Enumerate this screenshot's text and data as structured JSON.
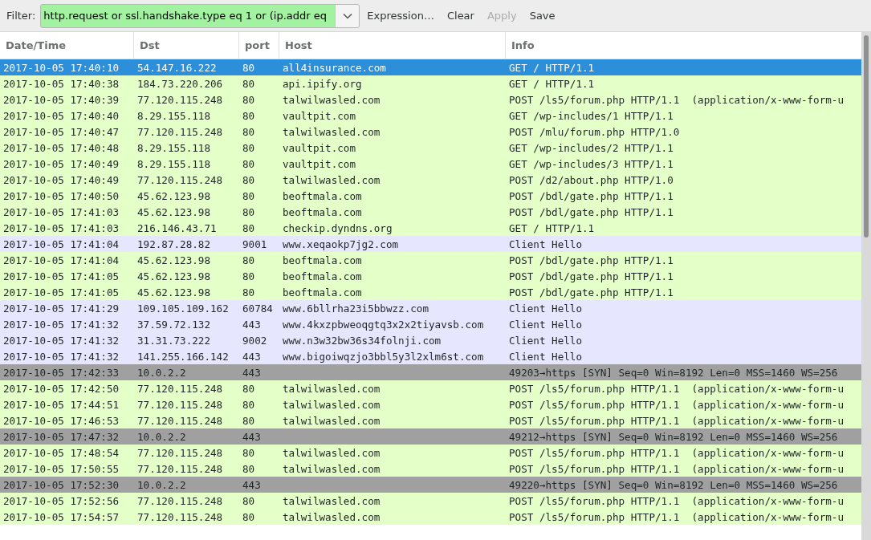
{
  "toolbar": {
    "filter_label": "Filter:",
    "filter_value": "http.request or ssl.handshake.type eq 1 or (ip.addr eq",
    "buttons": [
      {
        "label": "Expression…",
        "disabled": false
      },
      {
        "label": "Clear",
        "disabled": false
      },
      {
        "label": "Apply",
        "disabled": true
      },
      {
        "label": "Save",
        "disabled": false
      }
    ]
  },
  "table": {
    "columns": [
      "Date/Time",
      "Dst",
      "port",
      "Host",
      "Info"
    ],
    "rows": [
      {
        "kind": "http",
        "selected": true,
        "cells": [
          "2017-10-05 17:40:10",
          "54.147.16.222",
          "80",
          "all4insurance.com",
          "GET / HTTP/1.1"
        ]
      },
      {
        "kind": "http",
        "selected": false,
        "cells": [
          "2017-10-05 17:40:38",
          "184.73.220.206",
          "80",
          "api.ipify.org",
          "GET / HTTP/1.1"
        ]
      },
      {
        "kind": "http",
        "selected": false,
        "cells": [
          "2017-10-05 17:40:39",
          "77.120.115.248",
          "80",
          "talwilwasled.com",
          "POST /ls5/forum.php HTTP/1.1  (application/x-www-form-u"
        ]
      },
      {
        "kind": "http",
        "selected": false,
        "cells": [
          "2017-10-05 17:40:40",
          "8.29.155.118",
          "80",
          "vaultpit.com",
          "GET /wp-includes/1 HTTP/1.1"
        ]
      },
      {
        "kind": "http",
        "selected": false,
        "cells": [
          "2017-10-05 17:40:47",
          "77.120.115.248",
          "80",
          "talwilwasled.com",
          "POST /mlu/forum.php HTTP/1.0"
        ]
      },
      {
        "kind": "http",
        "selected": false,
        "cells": [
          "2017-10-05 17:40:48",
          "8.29.155.118",
          "80",
          "vaultpit.com",
          "GET /wp-includes/2 HTTP/1.1"
        ]
      },
      {
        "kind": "http",
        "selected": false,
        "cells": [
          "2017-10-05 17:40:49",
          "8.29.155.118",
          "80",
          "vaultpit.com",
          "GET /wp-includes/3 HTTP/1.1"
        ]
      },
      {
        "kind": "http",
        "selected": false,
        "cells": [
          "2017-10-05 17:40:49",
          "77.120.115.248",
          "80",
          "talwilwasled.com",
          "POST /d2/about.php HTTP/1.0"
        ]
      },
      {
        "kind": "http",
        "selected": false,
        "cells": [
          "2017-10-05 17:40:50",
          "45.62.123.98",
          "80",
          "beoftmala.com",
          "POST /bdl/gate.php HTTP/1.1"
        ]
      },
      {
        "kind": "http",
        "selected": false,
        "cells": [
          "2017-10-05 17:41:03",
          "45.62.123.98",
          "80",
          "beoftmala.com",
          "POST /bdl/gate.php HTTP/1.1"
        ]
      },
      {
        "kind": "http",
        "selected": false,
        "cells": [
          "2017-10-05 17:41:03",
          "216.146.43.71",
          "80",
          "checkip.dyndns.org",
          "GET / HTTP/1.1"
        ]
      },
      {
        "kind": "tls",
        "selected": false,
        "cells": [
          "2017-10-05 17:41:04",
          "192.87.28.82",
          "9001",
          "www.xeqaokp7jg2.com",
          "Client Hello"
        ]
      },
      {
        "kind": "http",
        "selected": false,
        "cells": [
          "2017-10-05 17:41:04",
          "45.62.123.98",
          "80",
          "beoftmala.com",
          "POST /bdl/gate.php HTTP/1.1"
        ]
      },
      {
        "kind": "http",
        "selected": false,
        "cells": [
          "2017-10-05 17:41:05",
          "45.62.123.98",
          "80",
          "beoftmala.com",
          "POST /bdl/gate.php HTTP/1.1"
        ]
      },
      {
        "kind": "http",
        "selected": false,
        "cells": [
          "2017-10-05 17:41:05",
          "45.62.123.98",
          "80",
          "beoftmala.com",
          "POST /bdl/gate.php HTTP/1.1"
        ]
      },
      {
        "kind": "tls",
        "selected": false,
        "cells": [
          "2017-10-05 17:41:29",
          "109.105.109.162",
          "60784",
          "www.6bllrha23i5bbwzz.com",
          "Client Hello"
        ]
      },
      {
        "kind": "tls",
        "selected": false,
        "cells": [
          "2017-10-05 17:41:32",
          "37.59.72.132",
          "443",
          "www.4kxzpbweoqgtq3x2x2tiyavsb.com",
          "Client Hello"
        ]
      },
      {
        "kind": "tls",
        "selected": false,
        "cells": [
          "2017-10-05 17:41:32",
          "31.31.73.222",
          "9002",
          "www.n3w32bw36s34folnji.com",
          "Client Hello"
        ]
      },
      {
        "kind": "tls",
        "selected": false,
        "cells": [
          "2017-10-05 17:41:32",
          "141.255.166.142",
          "443",
          "www.bigoiwqzjo3bbl5y3l2xlm6st.com",
          "Client Hello"
        ]
      },
      {
        "kind": "tcp",
        "selected": false,
        "cells": [
          "2017-10-05 17:42:33",
          "10.0.2.2",
          "443",
          "",
          "49203→https [SYN] Seq=0 Win=8192 Len=0 MSS=1460 WS=256"
        ]
      },
      {
        "kind": "http",
        "selected": false,
        "cells": [
          "2017-10-05 17:42:50",
          "77.120.115.248",
          "80",
          "talwilwasled.com",
          "POST /ls5/forum.php HTTP/1.1  (application/x-www-form-u"
        ]
      },
      {
        "kind": "http",
        "selected": false,
        "cells": [
          "2017-10-05 17:44:51",
          "77.120.115.248",
          "80",
          "talwilwasled.com",
          "POST /ls5/forum.php HTTP/1.1  (application/x-www-form-u"
        ]
      },
      {
        "kind": "http",
        "selected": false,
        "cells": [
          "2017-10-05 17:46:53",
          "77.120.115.248",
          "80",
          "talwilwasled.com",
          "POST /ls5/forum.php HTTP/1.1  (application/x-www-form-u"
        ]
      },
      {
        "kind": "tcp",
        "selected": false,
        "cells": [
          "2017-10-05 17:47:32",
          "10.0.2.2",
          "443",
          "",
          "49212→https [SYN] Seq=0 Win=8192 Len=0 MSS=1460 WS=256"
        ]
      },
      {
        "kind": "http",
        "selected": false,
        "cells": [
          "2017-10-05 17:48:54",
          "77.120.115.248",
          "80",
          "talwilwasled.com",
          "POST /ls5/forum.php HTTP/1.1  (application/x-www-form-u"
        ]
      },
      {
        "kind": "http",
        "selected": false,
        "cells": [
          "2017-10-05 17:50:55",
          "77.120.115.248",
          "80",
          "talwilwasled.com",
          "POST /ls5/forum.php HTTP/1.1  (application/x-www-form-u"
        ]
      },
      {
        "kind": "tcp",
        "selected": false,
        "cells": [
          "2017-10-05 17:52:30",
          "10.0.2.2",
          "443",
          "",
          "49220→https [SYN] Seq=0 Win=8192 Len=0 MSS=1460 WS=256"
        ]
      },
      {
        "kind": "http",
        "selected": false,
        "cells": [
          "2017-10-05 17:52:56",
          "77.120.115.248",
          "80",
          "talwilwasled.com",
          "POST /ls5/forum.php HTTP/1.1  (application/x-www-form-u"
        ]
      },
      {
        "kind": "http",
        "selected": false,
        "cells": [
          "2017-10-05 17:54:57",
          "77.120.115.248",
          "80",
          "talwilwasled.com",
          "POST /ls5/forum.php HTTP/1.1  (application/x-www-form-u"
        ]
      }
    ]
  }
}
